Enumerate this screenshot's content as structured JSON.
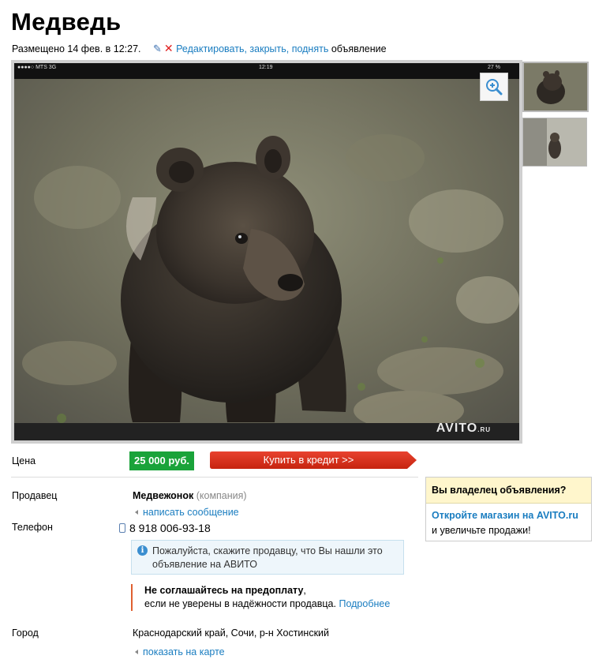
{
  "ad": {
    "title": "Медведь",
    "posted": "Размещено 14 фев. в 12:27.",
    "actions_link": "Редактировать, закрыть, поднять",
    "actions_suffix": " объявление"
  },
  "photo": {
    "status_left": "●●●●○ MTS  3G",
    "status_time": "12:19",
    "status_right": "27 %",
    "watermark": "AVITO",
    "watermark_suffix": ".RU",
    "thumbnail_count": 2
  },
  "price": {
    "label": "Цена",
    "value": "25 000 руб.",
    "credit_button": "Купить в кредит >>"
  },
  "seller": {
    "label": "Продавец",
    "name": "Медвежонок",
    "type": "(компания)",
    "write_link": "написать сообщение"
  },
  "phone": {
    "label": "Телефон",
    "number": "8 918 006-93-18"
  },
  "notice": {
    "text": "Пожалуйста, скажите продавцу, что Вы нашли это объявление на АВИТО"
  },
  "warning": {
    "bold": "Не соглашайтесь на предоплату",
    "comma": ",",
    "text": "если не уверены в надёжности продавца.",
    "more_link": "Подробнее"
  },
  "city": {
    "label": "Город",
    "value": "Краснодарский край, Сочи, р-н Хостинский",
    "map_link": "показать на карте"
  },
  "owner_box": {
    "title": "Вы владелец объявления?",
    "link": "Откройте магазин на AVITO.ru",
    "text": "и увеличьте продажи!"
  },
  "colors": {
    "price_bg": "#1aa33a",
    "credit_bg": "#d92d1e",
    "link": "#1a7dc0",
    "owner_head_bg": "#fff6cc"
  }
}
